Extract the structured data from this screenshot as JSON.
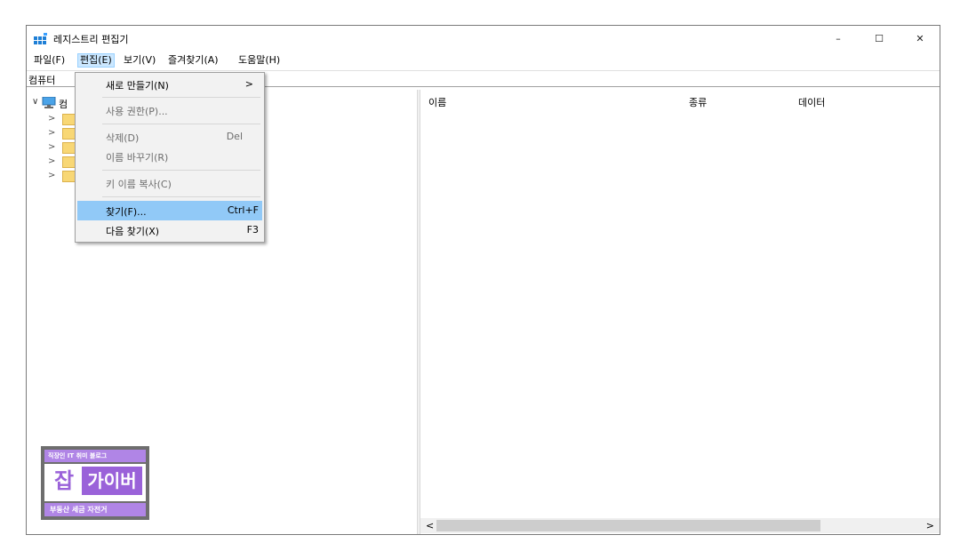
{
  "window": {
    "title": "레지스트리 편집기",
    "icon": "registry-icon",
    "controls": {
      "minimize": "–",
      "maximize": "☐",
      "close": "✕"
    }
  },
  "menubar": {
    "items": [
      {
        "label": "파일(F)"
      },
      {
        "label": "편집(E)"
      },
      {
        "label": "보기(V)"
      },
      {
        "label": "즐겨찾기(A)"
      },
      {
        "label": "도움말(H)"
      }
    ]
  },
  "address": {
    "text": "컴퓨터"
  },
  "tree": {
    "root_label": "컴",
    "expanded_glyph": "∨",
    "collapsed_glyph": ">",
    "child_count": 5
  },
  "list": {
    "columns": [
      {
        "label": "이름"
      },
      {
        "label": "종류"
      },
      {
        "label": "데이터"
      }
    ],
    "scroll_left": "<",
    "scroll_right": ">"
  },
  "edit_menu": {
    "items": [
      {
        "label": "새로 만들기(N)",
        "shortcut": "",
        "submenu_arrow": ">",
        "state": "enabled"
      },
      {
        "label": "사용 권한(P)...",
        "shortcut": "",
        "state": "disabled"
      },
      {
        "label": "삭제(D)",
        "shortcut": "Del",
        "state": "disabled"
      },
      {
        "label": "이름 바꾸기(R)",
        "shortcut": "",
        "state": "disabled"
      },
      {
        "label": "키 이름 복사(C)",
        "shortcut": "",
        "state": "disabled"
      },
      {
        "label": "찾기(F)...",
        "shortcut": "Ctrl+F",
        "state": "highlighted"
      },
      {
        "label": "다음 찾기(X)",
        "shortcut": "F3",
        "state": "enabled"
      }
    ]
  },
  "watermark": {
    "top": "직장인 IT 취미 블로그",
    "char1": "잡",
    "char2": "가이버",
    "bottom": "부동산 세금 자전거"
  },
  "colors": {
    "menu_highlight": "#91c9f7",
    "menu_active_bg": "#cce8ff",
    "watermark_purple": "#9a62d9",
    "watermark_light": "#b085e6"
  }
}
